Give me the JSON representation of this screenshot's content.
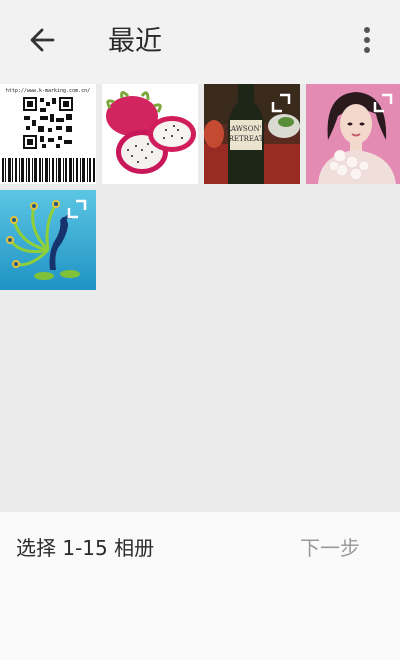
{
  "header": {
    "title": "最近",
    "back_icon": "arrow-left-icon",
    "menu_icon": "more-vert-icon"
  },
  "photos": [
    {
      "label": "qr-code-photo",
      "url_text": "http://www.k-marking.com.cn/"
    },
    {
      "label": "dragon-fruit-photo"
    },
    {
      "label": "wine-bottle-photo",
      "wine_label_line1": "RAWSON'S",
      "wine_label_line2": "RETREAT"
    },
    {
      "label": "portrait-photo"
    },
    {
      "label": "peacock-photo"
    }
  ],
  "footer": {
    "selection_text": "选择 1-15 相册",
    "next_label": "下一步"
  }
}
